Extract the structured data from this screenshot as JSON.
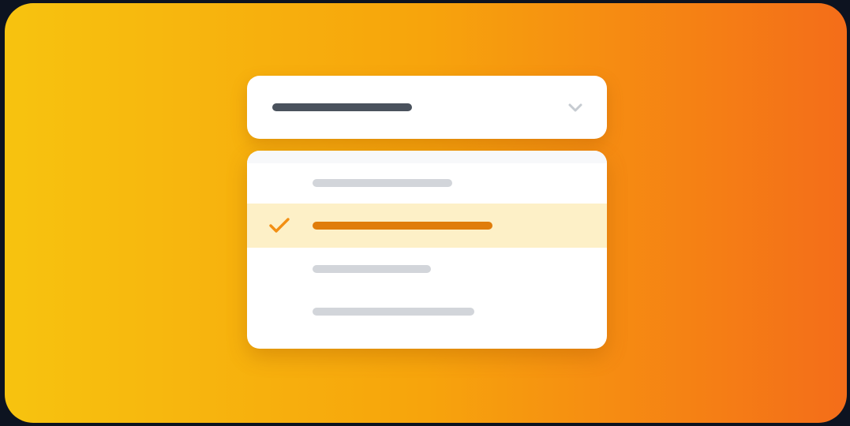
{
  "colors": {
    "background_dark": "#0d1320",
    "gradient_start": "#f7c30f",
    "gradient_mid": "#f7a40c",
    "gradient_end": "#f46d19",
    "select_value_bar": "#4a525d",
    "chevron": "#c6cbd1",
    "option_placeholder_bar": "#d2d5da",
    "selected_row_bg": "#fdf0c7",
    "selected_bar": "#e07d0b",
    "check_mark": "#f28f13"
  },
  "icons": {
    "dropdown_toggle": "chevron-down-icon",
    "selected_marker": "checkmark-icon"
  },
  "select": {
    "expanded": true
  },
  "dropdown": {
    "selected_index": 1,
    "option_count": 4
  }
}
